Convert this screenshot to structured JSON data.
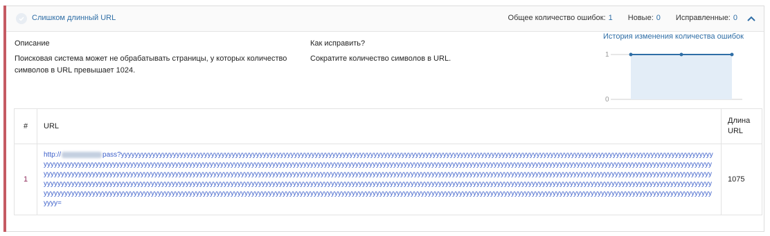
{
  "header": {
    "title": "Слишком длинный URL",
    "total_label": "Общее количество ошибок:",
    "total_value": "1",
    "new_label": "Новые:",
    "new_value": "0",
    "fixed_label": "Исправленные:",
    "fixed_value": "0"
  },
  "description": {
    "title": "Описание",
    "text": "Поисковая система может не обрабатывать страницы, у которых количество символов в URL превышает 1024."
  },
  "fix": {
    "title": "Как исправить?",
    "text": "Сократите количество символов в URL."
  },
  "history": {
    "link": "История изменения количества ошибок",
    "y_ticks": [
      "1",
      "0"
    ]
  },
  "chart_data": {
    "type": "area",
    "x": [
      1,
      2,
      3
    ],
    "values": [
      1,
      1,
      1
    ],
    "ylim": [
      0,
      1
    ],
    "y_ticks": [
      0,
      1
    ],
    "color": "#2f6ea6"
  },
  "table": {
    "headers": {
      "index": "#",
      "url": "URL",
      "length": "Длина URL"
    },
    "rows": [
      {
        "index": "1",
        "url_prefix": "http://",
        "url_rest": "pass?yyyyyyyyyyyyyyyyyyyyyyyyyyyyyyyyyyyyyyyyyyyyyyyyyyyyyyyyyyyyyyyyyyyyyyyyyyyyyyyyyyyyyyyyyyyyyyyyyyyyyyyyyyyyyyyyyyyyyyyyyyyyyyyyyyyyyyyyyyyyyyyyyyyyyyyyyyyyyyyyyyyyyyyyyyyyyyyyyyyyyyyyyyyyyyyyyyyyyyyyyyyyyyyyyyyyyyyyyyyyyyyyyyyyyyyyyyyyyyyyyyyyyyyyyyyyyyyyyyyyyyyyyyyyyyyyyyyyyyyyyyyyyyyyyyyyyyyyyyyyyyyyyyyyyyyyyyyyyyyyyyyyyyyyyyyyyyyyyyyyyyyyyyyyyyyyyyyyyyyyyyyyyyyyyyyyyyyyyyyyyyyyyyyyyyyyyyyyyyyyyyyyyyyyyyyyyyyyyyyyyyyyyyyyyyyyyyyyyyyyyyyyyyyyyyyyyyyyyyyyyyyyyyyyyyyyyyyyyyyyyyyyyyyyyyyyyyyyyyyyyyyyyyyyyyyyyyyyyyyyyyyyyyyyyyyyyyyyyyyyyyyyyyyyyyyyyyyyyyyyyyyyyyyyyyyyyyyyyyyyyyyyyyyyyyyyyyyyyyyyyyyyyyyyyyyyyyyyyyyyyyyyyyyyyyyyyyyyyyyyyyyyyyyyyyyyyyyyyyyyyyyyyyyyyyyyyyyyyyyyyyyyyyyyyyyyyyyyyyyyyyyyyyyyyyyyyyyyyyyyyyyyyyyyyyyyyyyyyyyyyyyyyyyyyyyyyyyyyyyyyyyyyyyyyyyyyyyyyyyyyyyyyyyyyyyyyyyyyyyyyyyyyyyyyyyyyyyyyyyyyyyyyyyyyyyyyyyyyyyyyyyyyyyyyyyyyyyyyyyyyyyyyyyyyyyyyyyyyyyyyyyyyyyyyyyyyyyyyyyyyyyyyyyyyyyyyyyyyyyyyyyyyyyyyyyyyyyyyyyyyyyyyyy=",
        "length": "1075"
      }
    ]
  },
  "colors": {
    "accent": "#c55a63",
    "link": "#2f6ea6",
    "url": "#3a5ec9"
  },
  "icons": {
    "check": "check-circle-icon",
    "collapse": "chevron-up-icon"
  }
}
